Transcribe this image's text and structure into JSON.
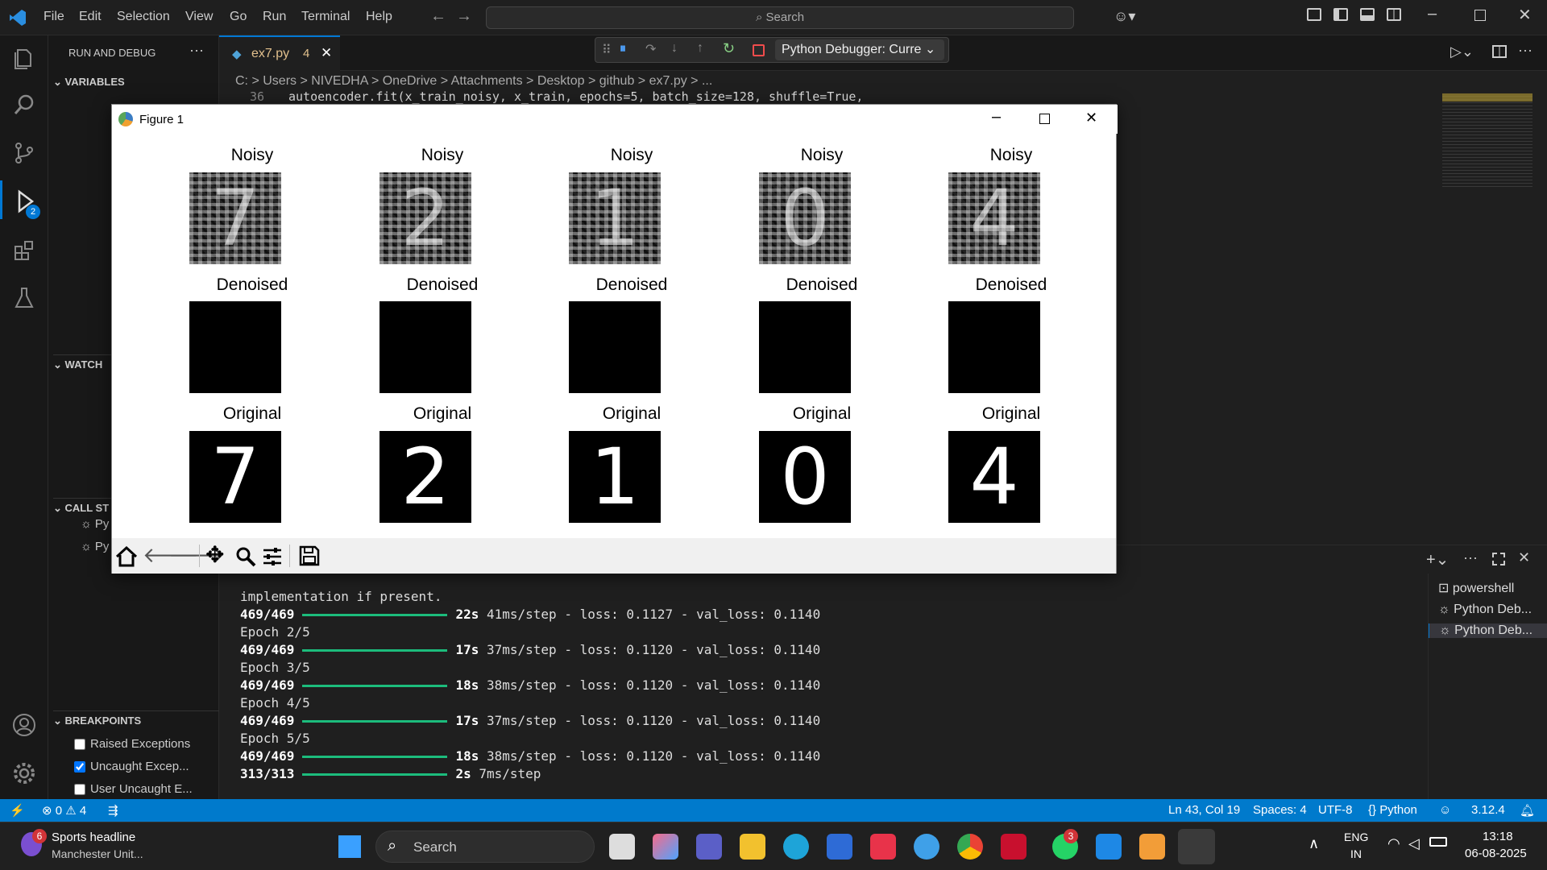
{
  "menu": [
    "File",
    "Edit",
    "Selection",
    "View",
    "Go",
    "Run",
    "Terminal",
    "Help"
  ],
  "search": {
    "label": "Search"
  },
  "sidebar": {
    "title": "RUN AND DEBUG",
    "variables": "VARIABLES",
    "watch": "WATCH",
    "callstack": "CALL ST",
    "callstack_items": [
      "Py",
      "Py"
    ],
    "breakpoints": "BREAKPOINTS",
    "bp_items": [
      {
        "label": "Raised Exceptions",
        "checked": false
      },
      {
        "label": "Uncaught Excep...",
        "checked": true
      },
      {
        "label": "User Uncaught E...",
        "checked": false
      }
    ]
  },
  "activity": {
    "debug_badge": "2"
  },
  "tab": {
    "label": "ex7.py",
    "problems": "4"
  },
  "breadcrumb": "C: > Users > NIVEDHA > OneDrive > Attachments > Desktop > github > ex7.py > ...",
  "code": {
    "line_no": "36",
    "text": "autoencoder.fit(x_train_noisy, x_train, epochs=5, batch_size=128, shuffle=True,"
  },
  "debugger": {
    "config": "Python Debugger: Curre"
  },
  "figure": {
    "title": "Figure 1",
    "rows": [
      {
        "title": "Noisy",
        "digits": [
          "7",
          "2",
          "1",
          "0",
          "4"
        ]
      },
      {
        "title": "Denoised",
        "digits": [
          "",
          "",
          "",
          "",
          ""
        ]
      },
      {
        "title": "Original",
        "digits": [
          "7",
          "2",
          "1",
          "0",
          "4"
        ]
      }
    ]
  },
  "terminal": {
    "lines": [
      {
        "type": "text",
        "text": "implementation if present."
      },
      {
        "type": "progress",
        "count": "469/469",
        "time": "22s",
        "rest": "41ms/step - loss: 0.1127 - val_loss: 0.1140"
      },
      {
        "type": "text",
        "text": "Epoch 2/5"
      },
      {
        "type": "progress",
        "count": "469/469",
        "time": "17s",
        "rest": "37ms/step - loss: 0.1120 - val_loss: 0.1140"
      },
      {
        "type": "text",
        "text": "Epoch 3/5"
      },
      {
        "type": "progress",
        "count": "469/469",
        "time": "18s",
        "rest": "38ms/step - loss: 0.1120 - val_loss: 0.1140"
      },
      {
        "type": "text",
        "text": "Epoch 4/5"
      },
      {
        "type": "progress",
        "count": "469/469",
        "time": "17s",
        "rest": "37ms/step - loss: 0.1120 - val_loss: 0.1140"
      },
      {
        "type": "text",
        "text": "Epoch 5/5"
      },
      {
        "type": "progress",
        "count": "469/469",
        "time": "18s",
        "rest": "38ms/step - loss: 0.1120 - val_loss: 0.1140"
      },
      {
        "type": "progress",
        "count": "313/313",
        "time": "2s",
        "rest": "7ms/step"
      }
    ],
    "list": [
      "powershell",
      "Python Deb...",
      "Python Deb..."
    ]
  },
  "status": {
    "errors": "0",
    "warnings": "4",
    "position": "Ln 43, Col 19",
    "spaces": "Spaces: 4",
    "encoding": "UTF-8",
    "language": "Python",
    "version": "3.12.4"
  },
  "taskbar": {
    "news_title": "Sports headline",
    "news_sub": "Manchester Unit...",
    "news_badge": "6",
    "search": "Search",
    "whatsapp_badge": "3",
    "lang1": "ENG",
    "lang2": "IN",
    "time": "13:18",
    "date": "06-08-2025"
  },
  "colors": {
    "accent": "#007acc",
    "progress": "#1cbc7c"
  }
}
